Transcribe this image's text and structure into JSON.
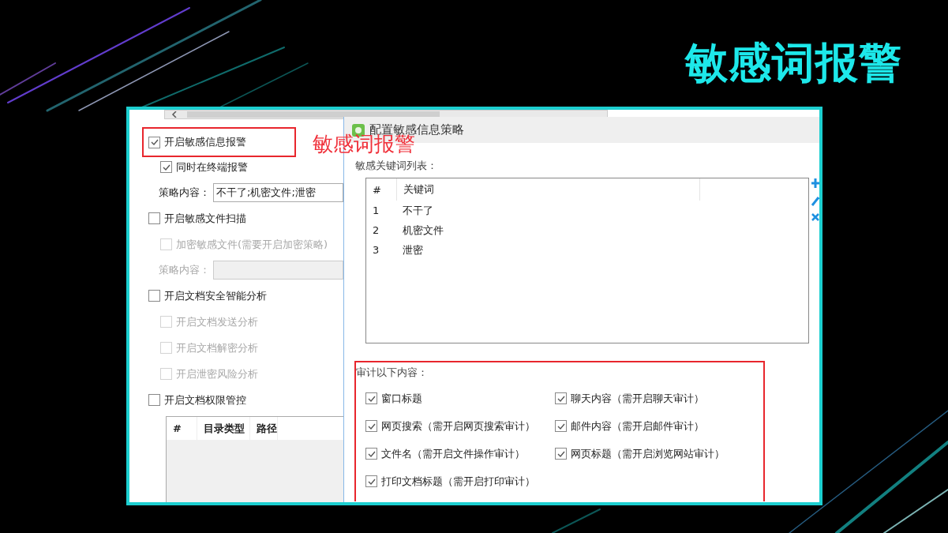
{
  "slide_title": "敏感词报警",
  "annotation": "敏感词报警",
  "settings": [
    {
      "kind": "checkbox",
      "label": "开启敏感信息报警",
      "checked": true,
      "disabled": false,
      "highlighted": true,
      "children": [
        {
          "kind": "checkbox",
          "label": "同时在终端报警",
          "checked": true,
          "disabled": false,
          "highlighted": false
        },
        {
          "kind": "field",
          "label": "策略内容：",
          "value": "不干了;机密文件;泄密",
          "disabled": false
        }
      ]
    },
    {
      "kind": "checkbox",
      "label": "开启敏感文件扫描",
      "checked": false,
      "disabled": false,
      "highlighted": false,
      "children": [
        {
          "kind": "checkbox",
          "label": "加密敏感文件(需要开启加密策略)",
          "checked": false,
          "disabled": true,
          "highlighted": false
        },
        {
          "kind": "field",
          "label": "策略内容：",
          "disabled": true
        }
      ]
    },
    {
      "kind": "checkbox",
      "label": "开启文档安全智能分析",
      "checked": false,
      "disabled": false,
      "highlighted": false,
      "children": [
        {
          "kind": "checkbox",
          "label": "开启文档发送分析",
          "checked": false,
          "disabled": true,
          "highlighted": false
        },
        {
          "kind": "checkbox",
          "label": "开启文档解密分析",
          "checked": false,
          "disabled": true,
          "highlighted": false
        },
        {
          "kind": "checkbox",
          "label": "开启泄密风险分析",
          "checked": false,
          "disabled": true,
          "highlighted": false
        }
      ]
    },
    {
      "kind": "checkbox",
      "label": "开启文档权限管控",
      "checked": false,
      "disabled": false,
      "highlighted": false,
      "children": [
        {
          "kind": "table",
          "columns": [
            "#",
            "目录类型",
            "路径"
          ]
        }
      ]
    }
  ],
  "dialog": {
    "title": "配置敏感信息策略",
    "list_label": "敏感关键词列表：",
    "table": {
      "columns": [
        "#",
        "关键词"
      ],
      "rows": [
        [
          "1",
          "不干了"
        ],
        [
          "2",
          "机密文件"
        ],
        [
          "3",
          "泄密"
        ]
      ]
    },
    "audit": {
      "label": "审计以下内容：",
      "highlighted": true,
      "items": [
        {
          "label": "窗口标题",
          "checked": true
        },
        {
          "label": "聊天内容（需开启聊天审计）",
          "checked": true
        },
        {
          "label": "网页搜索（需开启网页搜索审计）",
          "checked": true
        },
        {
          "label": "邮件内容（需开启邮件审计）",
          "checked": true
        },
        {
          "label": "文件名（需开启文件操作审计）",
          "checked": true
        },
        {
          "label": "网页标题（需开启浏览网站审计）",
          "checked": true
        },
        {
          "label": "打印文档标题（需开启打印审计）",
          "checked": true
        }
      ]
    }
  }
}
